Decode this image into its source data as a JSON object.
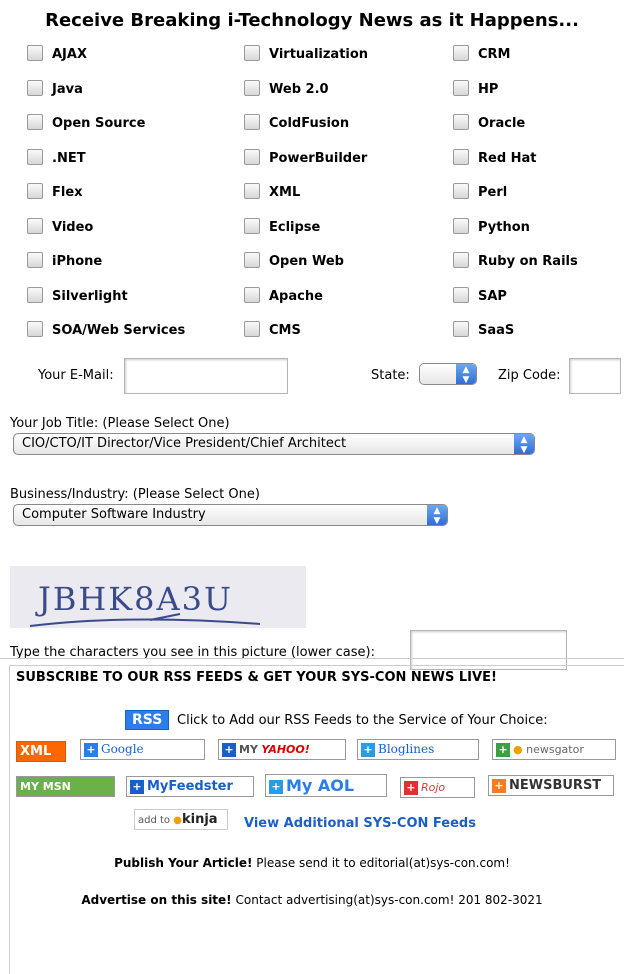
{
  "headline": "Receive Breaking i-Technology News as it Happens...",
  "topics": [
    "AJAX",
    "Virtualization",
    "CRM",
    "Java",
    "Web 2.0",
    "HP",
    "Open Source",
    "ColdFusion",
    "Oracle",
    ".NET",
    "PowerBuilder",
    "Red Hat",
    "Flex",
    "XML",
    "Perl",
    "Video",
    "Eclipse",
    "Python",
    "iPhone",
    "Open Web",
    "Ruby on Rails",
    "Silverlight",
    "Apache",
    "SAP",
    "SOA/Web Services",
    "CMS",
    "SaaS"
  ],
  "form": {
    "email_label": "Your E-Mail:",
    "state_label": "State:",
    "zip_label": "Zip Code:",
    "job_label": "Your Job Title: (Please Select One)",
    "job_value": "CIO/CTO/IT Director/Vice President/Chief Architect",
    "industry_label": "Business/Industry: (Please Select One)",
    "industry_value": "Computer Software Industry",
    "captcha_text": "JBHK8A3U",
    "captcha_prompt": "Type the characters you see in this picture (lower case):"
  },
  "rss": {
    "title": "SUBSCRIBE TO OUR RSS FEEDS & GET YOUR SYS-CON NEWS LIVE!",
    "badge": "RSS",
    "intro": "Click to Add our RSS Feeds to the Service of Your Choice:",
    "services": {
      "xml": "XML",
      "google": "Google",
      "yahoo_my": "MY",
      "yahoo": "YAHOO!",
      "bloglines": "Bloglines",
      "newsgator": "newsgator",
      "msn": "MY MSN",
      "myfeedster": "MyFeedster",
      "myaol": "My AOL",
      "rojo": "Rojo",
      "newsburst": "NEWSBURST",
      "kinja_prefix": "add to",
      "kinja": "kinja"
    },
    "view_more": "View Additional SYS-CON Feeds"
  },
  "publish": {
    "bold": "Publish Your Article!",
    "text": " Please send it to editorial(at)sys-con.com!"
  },
  "advertise": {
    "bold": "Advertise on this site!",
    "text": " Contact advertising(at)sys-con.com! 201 802-3021"
  },
  "colors": {
    "link": "#1a5fc8",
    "rss_orange": "#ff6600",
    "rss_blue": "#2b7de9"
  }
}
